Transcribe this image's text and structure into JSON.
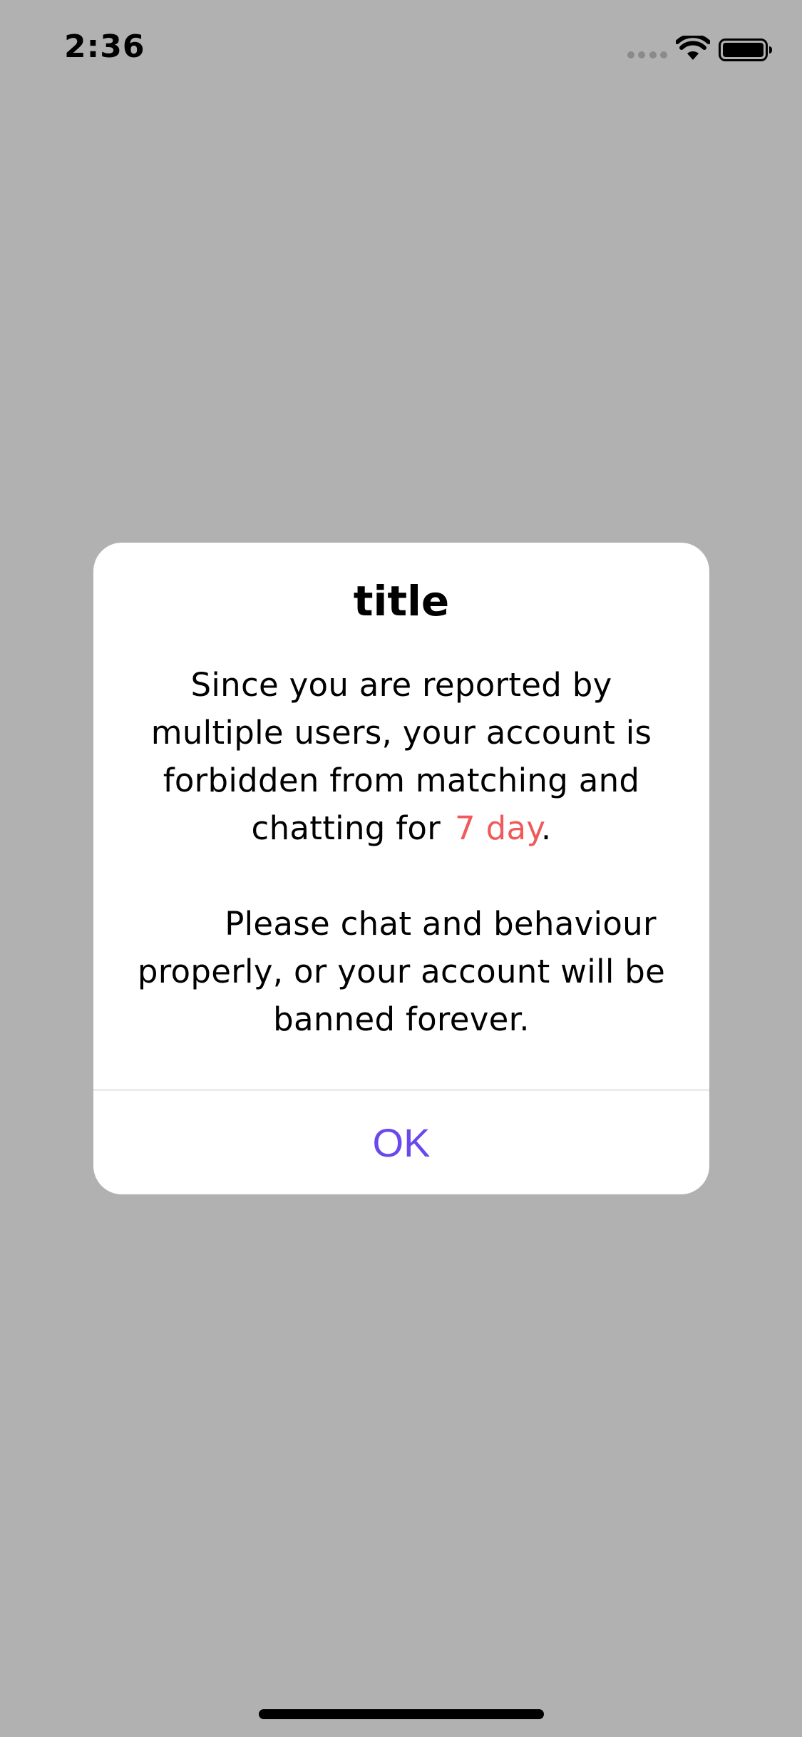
{
  "status_bar": {
    "time": "2:36",
    "icons": [
      "signal-dots-icon",
      "wifi-icon",
      "battery-icon"
    ]
  },
  "dialog": {
    "title": "title",
    "message_part1": "Since you are reported by multiple users, your account is forbidden from matching and chatting for",
    "highlight": "7 day",
    "message_part1_end": ".",
    "message_part2": "Please chat and behaviour properly, or your account will be banned forever.",
    "ok_label": "OK"
  },
  "colors": {
    "overlay_background": "#b1b1b1",
    "dialog_background": "#ffffff",
    "highlight": "#f05a5a",
    "ok_button": "#6b47ee"
  }
}
